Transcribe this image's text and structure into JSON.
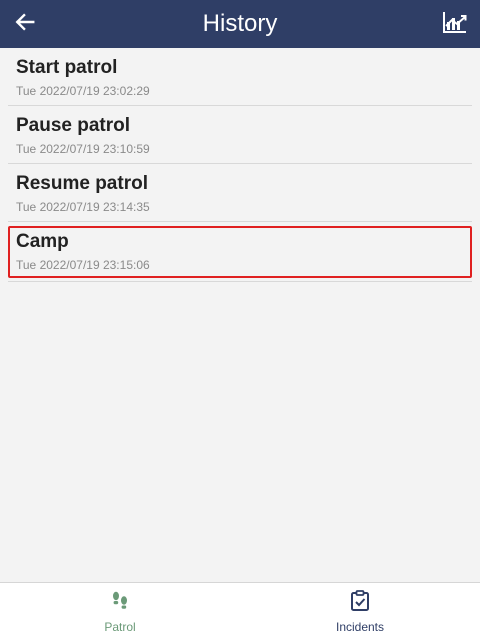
{
  "header": {
    "title": "History",
    "back_icon": "arrow-left-icon",
    "chart_icon": "chart-trend-icon"
  },
  "history": [
    {
      "title": "Start patrol",
      "time": "Tue 2022/07/19 23:02:29",
      "selected": false
    },
    {
      "title": "Pause patrol",
      "time": "Tue 2022/07/19 23:10:59",
      "selected": false
    },
    {
      "title": "Resume patrol",
      "time": "Tue 2022/07/19 23:14:35",
      "selected": false
    },
    {
      "title": "Camp",
      "time": "Tue 2022/07/19 23:15:06",
      "selected": true
    }
  ],
  "bottom_nav": {
    "items": [
      {
        "label": "Patrol",
        "icon": "footsteps-icon",
        "active": true
      },
      {
        "label": "Incidents",
        "icon": "clipboard-check-icon",
        "active": false
      }
    ]
  },
  "colors": {
    "app_bar": "#2f3e66",
    "background": "#f3f3f3",
    "selected_outline": "#e02020",
    "active_nav": "#6b9a78",
    "inactive_nav": "#2f3e66"
  }
}
